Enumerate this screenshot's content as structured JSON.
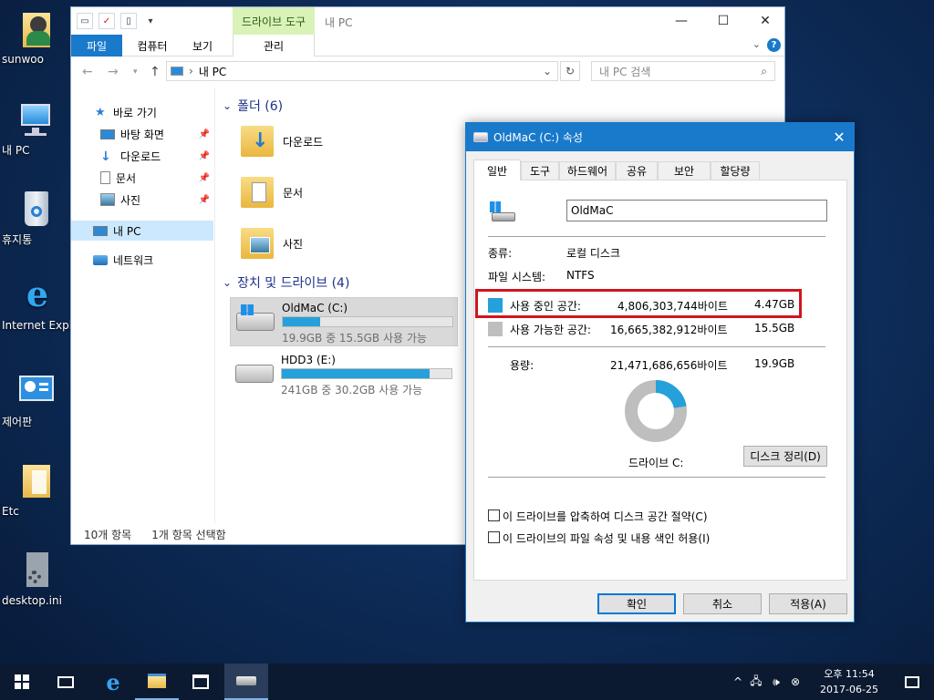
{
  "desktop": {
    "icons": [
      {
        "label": "sunwoo",
        "icon": "user-folder-icon"
      },
      {
        "label": "내 PC",
        "icon": "computer-icon"
      },
      {
        "label": "휴지통",
        "icon": "recycle-bin-icon"
      },
      {
        "label": "Internet Explorer",
        "icon": "internet-explorer-icon"
      },
      {
        "label": "제어판",
        "icon": "control-panel-icon"
      },
      {
        "label": "Etc",
        "icon": "folder-icon"
      },
      {
        "label": "desktop.ini",
        "icon": "settings-file-icon"
      }
    ]
  },
  "explorer": {
    "context_tab": "드라이브 도구",
    "title": "내 PC",
    "ribbon_tabs": [
      "파일",
      "컴퓨터",
      "보기",
      "관리"
    ],
    "address": "내 PC",
    "search_placeholder": "내 PC 검색",
    "nav": {
      "quick_access": "바로 가기",
      "pinned": [
        "바탕 화면",
        "다운로드",
        "문서",
        "사진"
      ],
      "this_pc": "내 PC",
      "network": "네트워크"
    },
    "folders_header": "폴더 (6)",
    "folders": [
      "다운로드",
      "문서",
      "사진"
    ],
    "drives_header": "장치 및 드라이브 (4)",
    "drives": [
      {
        "name": "OldMaC (C:)",
        "free_text": "19.9GB 중 15.5GB 사용 가능",
        "used_fraction": 0.22
      },
      {
        "name": "HDD3 (E:)",
        "free_text": "241GB 중 30.2GB 사용 가능",
        "used_fraction": 0.87
      }
    ],
    "status_items": "10개 항목",
    "status_selected": "1개 항목 선택함"
  },
  "dialog": {
    "title": "OldMaC (C:) 속성",
    "tabs": [
      "일반",
      "도구",
      "하드웨어",
      "공유",
      "보안",
      "할당량"
    ],
    "volume_name": "OldMaC",
    "type_label": "종류:",
    "type_value": "로컬 디스크",
    "fs_label": "파일 시스템:",
    "fs_value": "NTFS",
    "used_label": "사용 중인 공간:",
    "used_bytes": "4,806,303,744바이트",
    "used_size": "4.47GB",
    "free_label": "사용 가능한 공간:",
    "free_bytes": "16,665,382,912바이트",
    "free_size": "15.5GB",
    "capacity_label": "용량:",
    "capacity_bytes": "21,471,686,656바이트",
    "capacity_size": "19.9GB",
    "used_fraction": 0.224,
    "drive_label": "드라이브 C:",
    "cleanup_button": "디스크 정리(D)",
    "compress_label": "이 드라이브를 압축하여 디스크 공간 절약(C)",
    "index_label": "이 드라이브의 파일 속성 및 내용 색인 허용(I)",
    "ok": "확인",
    "cancel": "취소",
    "apply": "적용(A)",
    "colors": {
      "used": "#26a0da",
      "free": "#bebebe",
      "highlight": "#d0151c"
    }
  },
  "taskbar": {
    "time": "오후 11:54",
    "date": "2017-06-25"
  }
}
